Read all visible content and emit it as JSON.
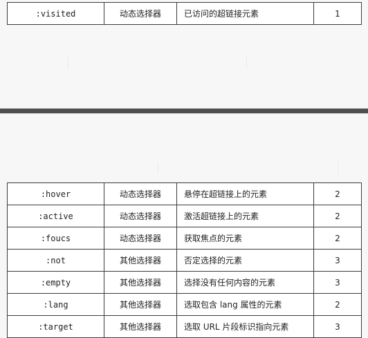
{
  "top_table": {
    "rows": [
      {
        "selector": ":visited",
        "type": "动态选择器",
        "description": "已访问的超链接元素",
        "version": "1"
      }
    ]
  },
  "bottom_table": {
    "rows": [
      {
        "selector": ":hover",
        "type": "动态选择器",
        "description": "悬停在超链接上的元素",
        "version": "2"
      },
      {
        "selector": ":active",
        "type": "动态选择器",
        "description": "激活超链接上的元素",
        "version": "2"
      },
      {
        "selector": ":foucs",
        "type": "动态选择器",
        "description": "获取焦点的元素",
        "version": "2"
      },
      {
        "selector": ":not",
        "type": "其他选择器",
        "description": "否定选择的元素",
        "version": "3"
      },
      {
        "selector": ":empty",
        "type": "其他选择器",
        "description": "选择没有任何内容的元素",
        "version": "3"
      },
      {
        "selector": ":lang",
        "type": "其他选择器",
        "description": "选取包含 lang 属性的元素",
        "version": "2"
      },
      {
        "selector": ":target",
        "type": "其他选择器",
        "description": "选取 URL 片段标识指向元素",
        "version": "3"
      }
    ]
  }
}
